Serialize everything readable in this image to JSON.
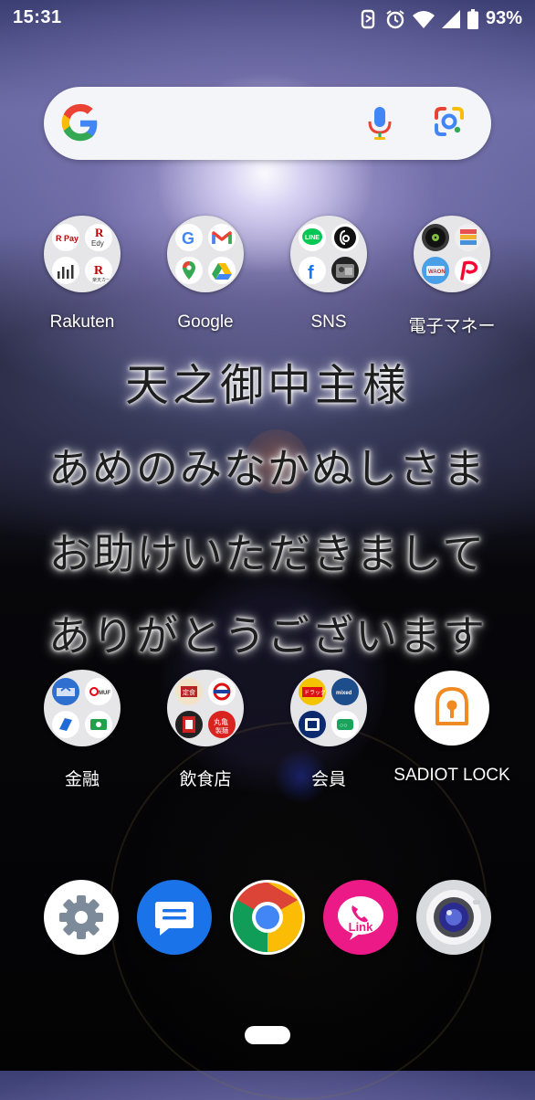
{
  "status_bar": {
    "time": "15:31",
    "battery": "93%"
  },
  "search_bar": {
    "placeholder": ""
  },
  "folders_row1": [
    {
      "label": "Rakuten",
      "mini_icons": [
        "rakuten-pay-icon",
        "rakuten-edy-icon",
        "rakuten-securities-icon",
        "rakuten-card-icon"
      ]
    },
    {
      "label": "Google",
      "mini_icons": [
        "google-icon",
        "gmail-icon",
        "google-maps-icon",
        "google-drive-icon"
      ]
    },
    {
      "label": "SNS",
      "mini_icons": [
        "line-icon",
        "threads-icon",
        "facebook-icon",
        "photo-app-icon"
      ]
    },
    {
      "label": "電子マネー",
      "mini_icons": [
        "vinyl-icon",
        "card-wallet-icon",
        "waon-icon",
        "paypay-icon"
      ]
    }
  ],
  "wallpaper_text": {
    "line1": "天之御中主様",
    "line2": "あめのみなかぬしさま",
    "line3": "お助けいただきまして",
    "line4": "ありがとうございます"
  },
  "folders_row2": [
    {
      "label": "金融",
      "mini_icons": [
        "bank-app-icon",
        "mufg-icon",
        "finance-app-icon",
        "money-app-icon"
      ]
    },
    {
      "label": "飲食店",
      "mini_icons": [
        "food-app-icon",
        "restaurant-app-icon",
        "food-menu-icon",
        "marugame-icon"
      ]
    },
    {
      "label": "会員",
      "mini_icons": [
        "member-card-icon",
        "mixed-media-icon",
        "coupon-icon",
        "membership-icon"
      ]
    }
  ],
  "sadiot_app": {
    "label": "SADIOT LOCK"
  },
  "dock": [
    {
      "name": "settings-icon"
    },
    {
      "name": "messages-icon"
    },
    {
      "name": "chrome-icon"
    },
    {
      "name": "link-icon",
      "text": "Link"
    },
    {
      "name": "camera-icon"
    }
  ],
  "colors": {
    "accent_orange": "#f08a24",
    "link_pink": "#ec1a86",
    "messages_blue": "#1a73e8"
  }
}
